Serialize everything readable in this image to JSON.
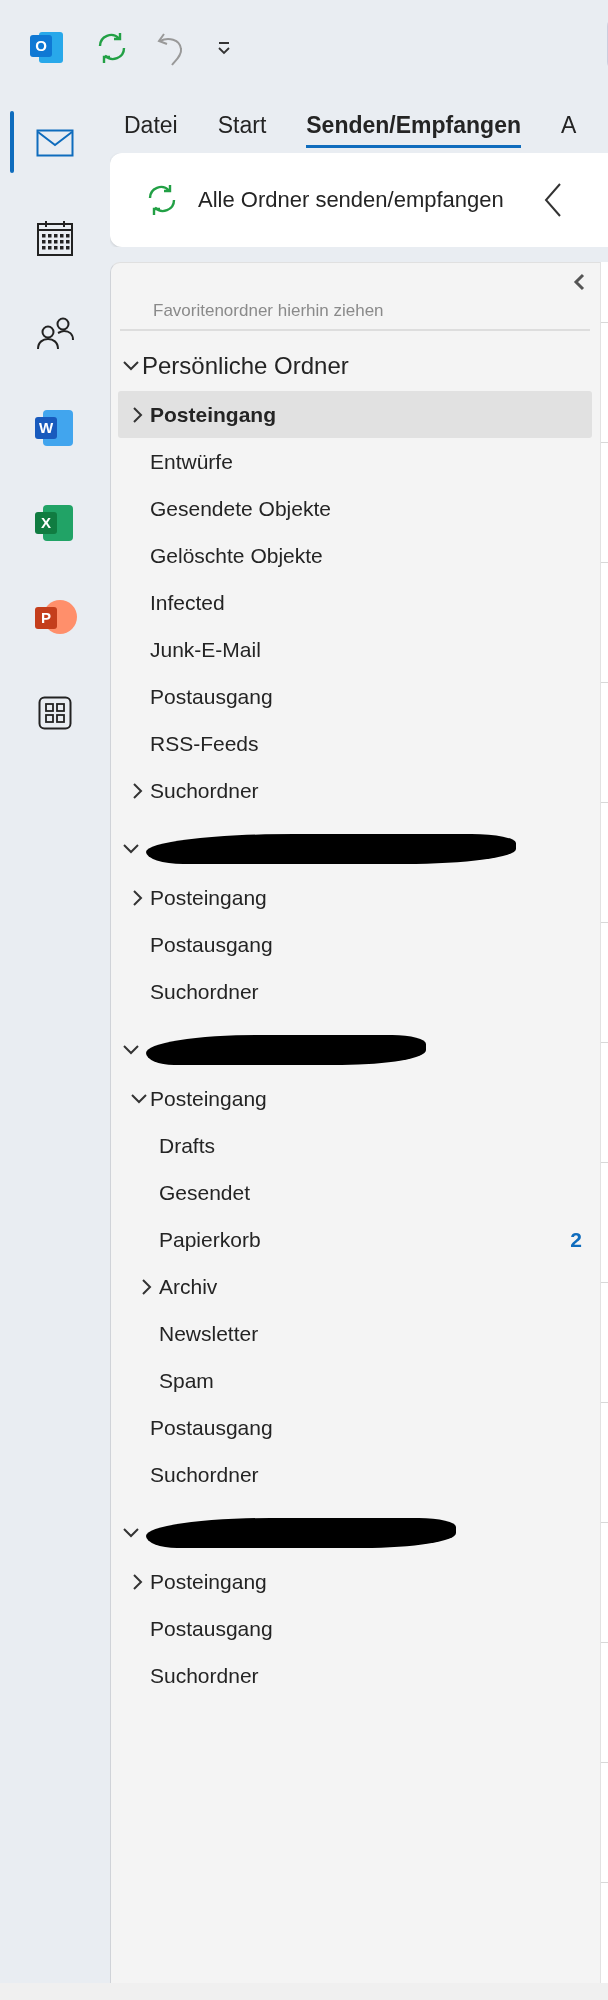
{
  "quick_access": {
    "app_badge": "O"
  },
  "nav": [
    {
      "kind": "mail",
      "selected": true
    },
    {
      "kind": "calendar",
      "selected": false
    },
    {
      "kind": "people",
      "selected": false
    },
    {
      "kind": "word",
      "selected": false,
      "badge": "W"
    },
    {
      "kind": "excel",
      "selected": false,
      "badge": "X"
    },
    {
      "kind": "powerpoint",
      "selected": false,
      "badge": "P"
    },
    {
      "kind": "apps",
      "selected": false
    }
  ],
  "tabs": [
    {
      "label": "Datei",
      "selected": false
    },
    {
      "label": "Start",
      "selected": false
    },
    {
      "label": "Senden/Empfangen",
      "selected": true
    },
    {
      "label": "A",
      "selected": false
    }
  ],
  "ribbon": {
    "button": "Alle Ordner senden/empfangen"
  },
  "folder_pane": {
    "favorites_hint": "Favoritenordner hierhin ziehen",
    "accounts": [
      {
        "name": "Persönliche Ordner",
        "redacted": false,
        "expanded": true,
        "folders": [
          {
            "name": "Posteingang",
            "selected": true,
            "expanded": false
          },
          {
            "name": "Entwürfe",
            "selected": false
          },
          {
            "name": "Gesendete Objekte",
            "selected": false
          },
          {
            "name": "Gelöschte Objekte",
            "selected": false
          },
          {
            "name": "Infected",
            "selected": false
          },
          {
            "name": "Junk-E-Mail",
            "selected": false
          },
          {
            "name": "Postausgang",
            "selected": false
          },
          {
            "name": "RSS-Feeds",
            "selected": false
          },
          {
            "name": "Suchordner",
            "selected": false,
            "expanded": false
          }
        ]
      },
      {
        "redacted": true,
        "expanded": true,
        "folders": [
          {
            "name": "Posteingang",
            "selected": false,
            "expanded": false
          },
          {
            "name": "Postausgang",
            "selected": false
          },
          {
            "name": "Suchordner",
            "selected": false
          }
        ]
      },
      {
        "redacted": true,
        "expanded": true,
        "folders": [
          {
            "name": "Posteingang",
            "selected": false,
            "expanded": true,
            "children": [
              {
                "name": "Drafts",
                "selected": false
              },
              {
                "name": "Gesendet",
                "selected": false
              },
              {
                "name": "Papierkorb",
                "selected": false,
                "count": "2"
              },
              {
                "name": "Archiv",
                "selected": false,
                "expanded": false
              },
              {
                "name": "Newsletter",
                "selected": false
              },
              {
                "name": "Spam",
                "selected": false
              }
            ]
          },
          {
            "name": "Postausgang",
            "selected": false
          },
          {
            "name": "Suchordner",
            "selected": false
          }
        ]
      },
      {
        "redacted": true,
        "expanded": true,
        "folders": [
          {
            "name": "Posteingang",
            "selected": false,
            "expanded": false
          },
          {
            "name": "Postausgang",
            "selected": false
          },
          {
            "name": "Suchordner",
            "selected": false
          }
        ]
      }
    ]
  }
}
